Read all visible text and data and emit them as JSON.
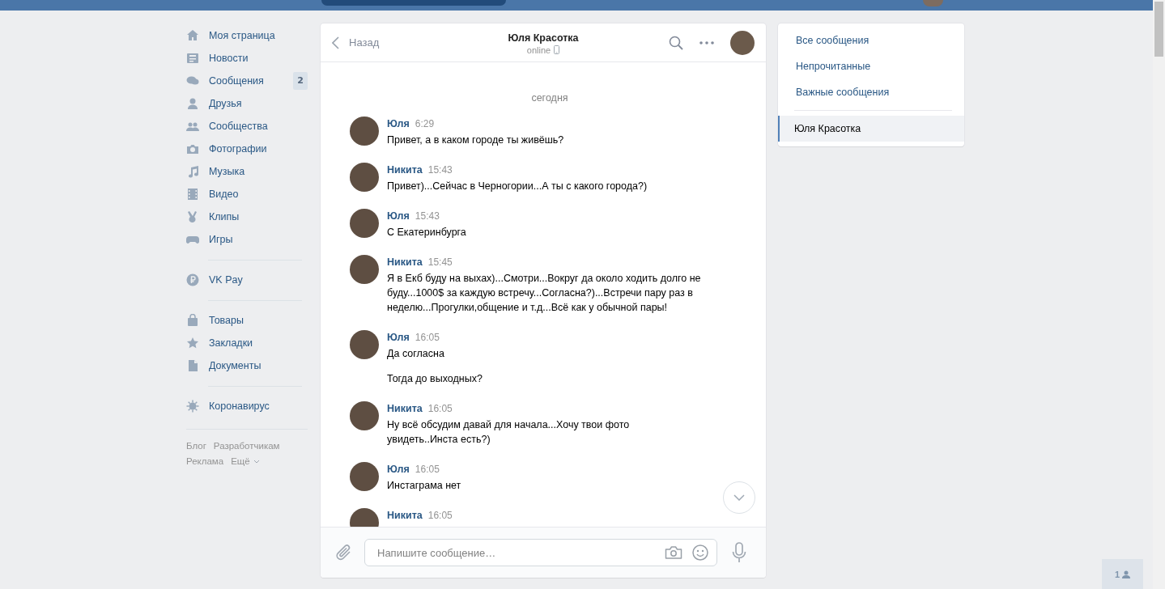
{
  "nav": {
    "groups": [
      [
        {
          "label": "Моя страница"
        },
        {
          "label": "Новости"
        },
        {
          "label": "Сообщения",
          "badge": "2"
        },
        {
          "label": "Друзья"
        },
        {
          "label": "Сообщества"
        },
        {
          "label": "Фотографии"
        },
        {
          "label": "Музыка"
        },
        {
          "label": "Видео"
        },
        {
          "label": "Клипы"
        },
        {
          "label": "Игры"
        }
      ],
      [
        {
          "label": "VK Pay"
        }
      ],
      [
        {
          "label": "Товары"
        },
        {
          "label": "Закладки"
        },
        {
          "label": "Документы"
        }
      ],
      [
        {
          "label": "Коронавирус"
        }
      ]
    ],
    "footer_links": [
      {
        "label": "Блог"
      },
      {
        "label": "Разработчикам"
      },
      {
        "label": "Реклама"
      },
      {
        "label": "Ещё",
        "dropdown": true
      }
    ]
  },
  "chat": {
    "back": "Назад",
    "title": "Юля Красотка",
    "status": "online",
    "date": "сегодня",
    "messages": [
      {
        "author": "Юля",
        "time": "6:29",
        "paragraphs": [
          "Привет, а в каком городе ты живёшь?"
        ]
      },
      {
        "author": "Никита",
        "time": "15:43",
        "paragraphs": [
          "Привет)...Сейчас в Черногории...А ты с какого города?)"
        ]
      },
      {
        "author": "Юля",
        "time": "15:43",
        "paragraphs": [
          "С Екатеринбурга"
        ]
      },
      {
        "author": "Никита",
        "time": "15:45",
        "paragraphs": [
          "Я в Екб буду на выхах)...Смотри...Вокруг да около ходить долго не буду...1000$ за каждую встречу...Согласна?)...Встречи пару раз в неделю...Прогулки,общение и т.д...Всё как у обычной пары!"
        ]
      },
      {
        "author": "Юля",
        "time": "16:05",
        "paragraphs": [
          "Да согласна",
          "Тогда до выходных?"
        ]
      },
      {
        "author": "Никита",
        "time": "16:05",
        "paragraphs": [
          "Ну всё обсудим давай для начала...Хочу твои фото\nувидеть..Инста есть?)"
        ]
      },
      {
        "author": "Юля",
        "time": "16:05",
        "paragraphs": [
          "Инстаграма нет"
        ]
      },
      {
        "author": "Никита",
        "time": "16:05"
      }
    ],
    "composer": {
      "placeholder": "Напишите сообщение…"
    }
  },
  "right_panel": {
    "filters": [
      {
        "label": "Все сообщения",
        "selected": false
      },
      {
        "label": "Непрочитанные",
        "selected": false
      },
      {
        "label": "Важные сообщения",
        "selected": false
      }
    ],
    "conversations": [
      {
        "label": "Юля Красотка",
        "selected": true
      }
    ]
  },
  "friends_online": {
    "count": "1"
  }
}
